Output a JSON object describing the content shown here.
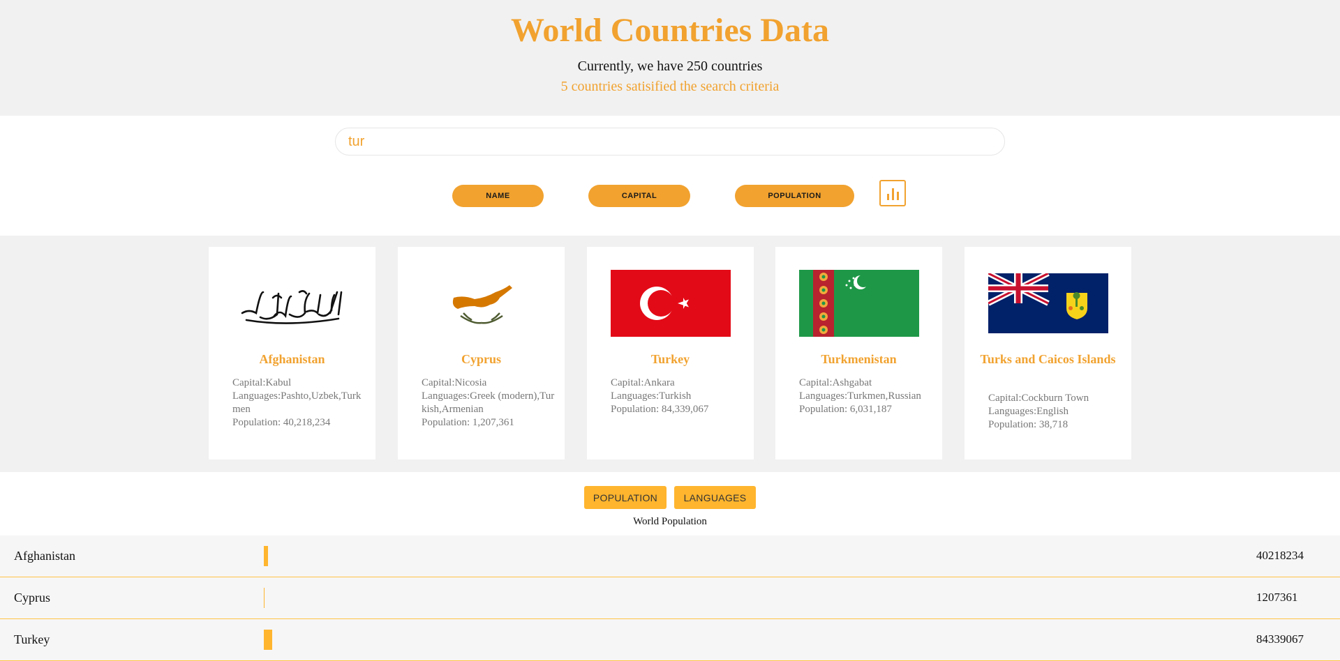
{
  "header": {
    "title": "World Countries Data",
    "subtitle": "Currently, we have 250 countries",
    "feedback": "5 countries satisified the search criteria"
  },
  "search": {
    "value": "tur"
  },
  "sort_buttons": {
    "name": "NAME",
    "capital": "CAPITAL",
    "population": "POPULATION"
  },
  "stats_icon": "bar-chart-icon",
  "cards": [
    {
      "name": "Afghanistan",
      "capital": "Capital:Kabul",
      "languages": "Languages:Pashto,Uzbek,Turkmen",
      "population": "Population:  40,218,234"
    },
    {
      "name": "Cyprus",
      "capital": "Capital:Nicosia",
      "languages": "Languages:Greek (modern),Turkish,Armenian",
      "population": "Population:  1,207,361"
    },
    {
      "name": "Turkey",
      "capital": "Capital:Ankara",
      "languages": "Languages:Turkish",
      "population": "Population:  84,339,067"
    },
    {
      "name": "Turkmenistan",
      "capital": "Capital:Ashgabat",
      "languages": "Languages:Turkmen,Russian",
      "population": "Population:  6,031,187"
    },
    {
      "name": "Turks and Caicos Islands",
      "capital": "Capital:Cockburn Town",
      "languages": "Languages:English",
      "population": "Population:  38,718"
    }
  ],
  "graph": {
    "population_label": "POPULATION",
    "languages_label": "LANGUAGES",
    "title": "World Population",
    "max_value": 7800000000,
    "rows": [
      {
        "label": "Afghanistan",
        "value": 40218234,
        "display": "40218234",
        "fill_fraction": 0.004
      },
      {
        "label": "Cyprus",
        "value": 1207361,
        "display": "1207361",
        "fill_fraction": 0.0008
      },
      {
        "label": "Turkey",
        "value": 84339067,
        "display": "84339067",
        "fill_fraction": 0.009
      }
    ]
  },
  "colors": {
    "accent": "#f1a22f",
    "bar": "#ffb52e",
    "band": "#f1f1f1"
  }
}
